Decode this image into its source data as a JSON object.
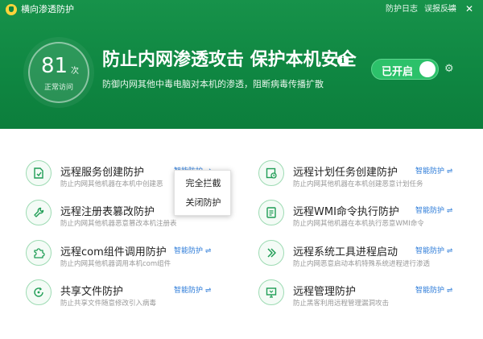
{
  "titlebar": {
    "app_title": "横向渗透防护",
    "log_link": "防护日志",
    "feedback_link": "误报反馈",
    "minimize": "—",
    "close": "✕"
  },
  "hero": {
    "count": "81",
    "count_unit": "次",
    "count_label": "正常访问",
    "headline": "防止内网渗透攻击 保护本机安全",
    "info_icon": "i",
    "subline": "防御内网其他中毒电脑对本机的渗透，阻断病毒传播扩散",
    "toggle_label": "已开启",
    "gear": "⚙"
  },
  "colors": {
    "header_green": "#0f8742",
    "toggle_green": "#2cc16a",
    "link_blue": "#2a7ad8"
  },
  "items": [
    {
      "title": "远程服务创建防护",
      "desc": "防止内网其他机器在本机中创建恶",
      "mode": "智能防护 ⇌",
      "icon": "service-icon"
    },
    {
      "title": "远程计划任务创建防护",
      "desc": "防止内网其他机器在本机创建恶意计划任务",
      "mode": "智能防护 ⇌",
      "icon": "task-icon"
    },
    {
      "title": "远程注册表篡改防护",
      "desc": "防止内网其他机器恶意篡改本机注册表",
      "mode": "",
      "icon": "wrench-icon"
    },
    {
      "title": "远程WMI命令执行防护",
      "desc": "防止内网其他机器在本机执行恶意WMI命令",
      "mode": "智能防护 ⇌",
      "icon": "command-icon"
    },
    {
      "title": "远程com组件调用防护",
      "desc": "防止内网其他机器调用本机com组件",
      "mode": "智能防护 ⇌",
      "icon": "puzzle-icon"
    },
    {
      "title": "远程系统工具进程启动",
      "desc": "防止内网恶意启动本机特殊系统进程进行渗透",
      "mode": "智能防护 ⇌",
      "icon": "arrows-icon"
    },
    {
      "title": "共享文件防护",
      "desc": "防止共享文件随意修改引入病毒",
      "mode": "智能防护 ⇌",
      "icon": "share-icon"
    },
    {
      "title": "远程管理防护",
      "desc": "防止黑客利用远程管理漏洞攻击",
      "mode": "智能防护 ⇌",
      "icon": "remote-icon"
    }
  ],
  "menu": {
    "option1": "完全拦截",
    "option2": "关闭防护"
  }
}
